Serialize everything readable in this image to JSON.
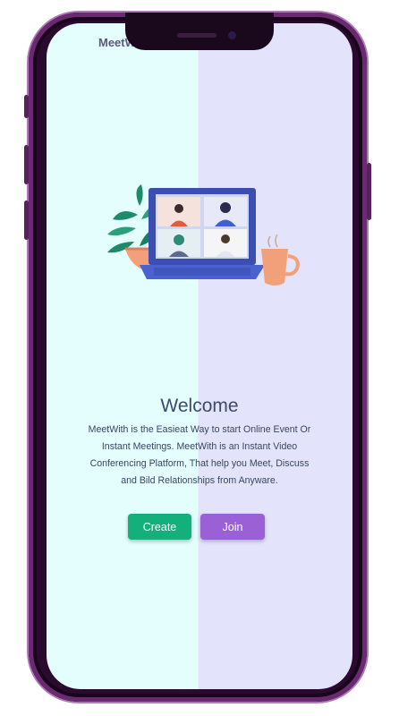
{
  "app": {
    "name": "MeetWith"
  },
  "welcome": {
    "title": "Welcome",
    "description_lines": [
      "MeetWith is the Easieat Way to start Online Event Or",
      "Instant Meetings. MeetWith is an Instant Video",
      "Conferencing Platform, That help you Meet, Discuss",
      "and Bild Relationships from Anyware."
    ]
  },
  "buttons": {
    "create_label": "Create",
    "join_label": "Join"
  },
  "colors": {
    "left_bg": "#e4fdfd",
    "right_bg": "#e3e4fb",
    "create": "#13b07c",
    "join": "#9b5fd6",
    "phone_frame": "#6a2a72"
  },
  "icons": {
    "illustration": "video-conference-laptop-illustration"
  }
}
